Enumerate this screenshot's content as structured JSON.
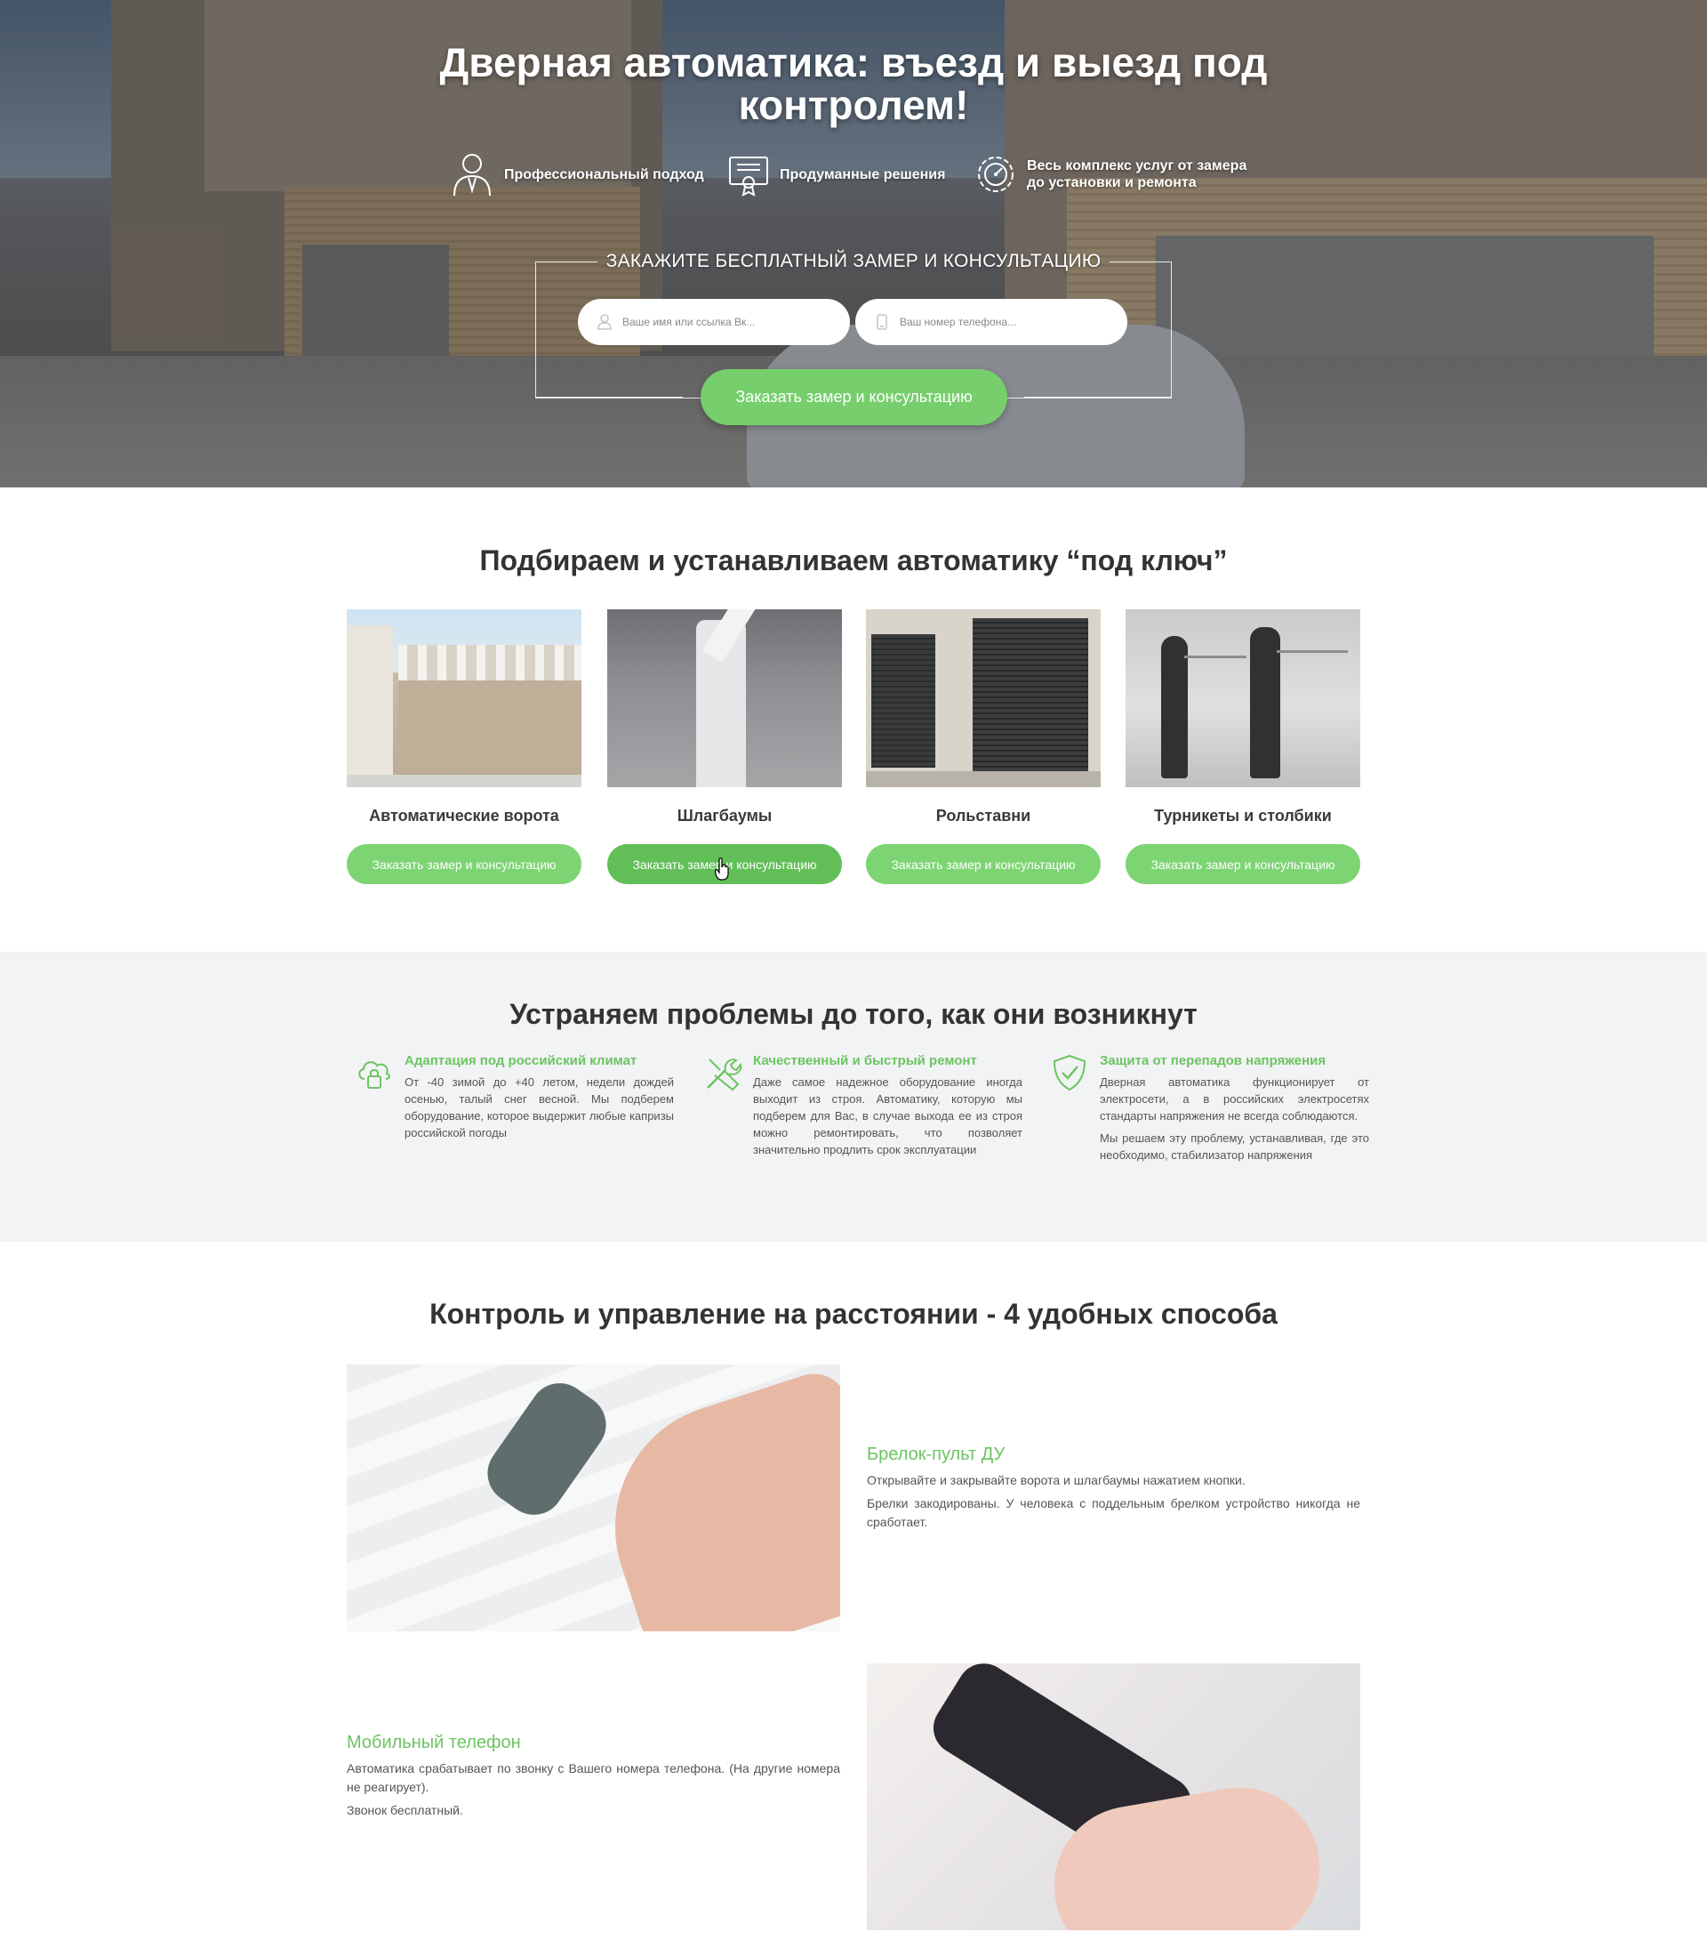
{
  "hero": {
    "title_line1": "Дверная автоматика: въезд и выезд под",
    "title_line2": "контролем!",
    "features": [
      {
        "label": "Профессиональный подход",
        "icon": "professional-icon"
      },
      {
        "label": "Продуманные решения",
        "icon": "certificate-icon"
      },
      {
        "label_line1": "Весь комплекс услуг от замера",
        "label_line2": "до установки и ремонта",
        "icon": "gear-icon"
      }
    ],
    "form_title": "ЗАКАЖИТЕ БЕСПЛАТНЫЙ ЗАМЕР И КОНСУЛЬТАЦИЮ",
    "name_placeholder": "Ваше имя или ссылка Вк...",
    "phone_placeholder": "Ваш номер телефона...",
    "submit_label": "Заказать замер и консультацию"
  },
  "products": {
    "title": "Подбираем и устанавливаем автоматику “под ключ”",
    "items": [
      {
        "name": "Автоматические ворота",
        "button": "Заказать замер и консультацию"
      },
      {
        "name": "Шлагбаумы",
        "button": "Заказать замер и консультацию"
      },
      {
        "name": "Рольставни",
        "button": "Заказать замер и консультацию"
      },
      {
        "name": "Турникеты и столбики",
        "button": "Заказать замер и консультацию"
      }
    ]
  },
  "problems": {
    "title": "Устраняем проблемы до того, как они возникнут",
    "items": [
      {
        "title": "Адаптация под российский климат",
        "icon": "cloud-lock-icon",
        "text": "От -40 зимой до +40 летом, недели дождей осенью, талый снег весной. Мы подберем оборудование, которое выдержит любые капризы российской погоды"
      },
      {
        "title": "Качественный и быстрый ремонт",
        "icon": "tools-icon",
        "text": "Даже самое надежное оборудование иногда выходит из строя. Автоматику, которую мы подберем для Вас, в случае выхода ее из строя можно ремонтировать, что позволяет значительно продлить срок эксплуатации"
      },
      {
        "title": "Защита от перепадов напряжения",
        "icon": "shield-check-icon",
        "text": "Дверная автоматика функционирует от электросети, а в российских электросетях стандарты напряжения не всегда соблюдаются.",
        "text2": "Мы решаем эту проблему, устанавливая, где это необходимо, стабилизатор напряжения"
      }
    ]
  },
  "control": {
    "title": "Контроль и управление на расстоянии - 4 удобных способа",
    "items": [
      {
        "title": "Брелок-пульт ДУ",
        "p1": "Открывайте и закрывайте ворота и шлагбаумы нажатием кнопки.",
        "p2": "Брелки закодированы. У человека с поддельным брелком устройство никогда не сработает."
      },
      {
        "title": "Мобильный телефон",
        "p1": "Автоматика срабатывает по звонку с Вашего номера телефона. (На другие номера не реагирует).",
        "p2": "Звонок бесплатный."
      }
    ]
  },
  "colors": {
    "accent_green": "#76cf6c",
    "heading_green": "#6cc462",
    "gray_section": "#f2f3f5"
  }
}
